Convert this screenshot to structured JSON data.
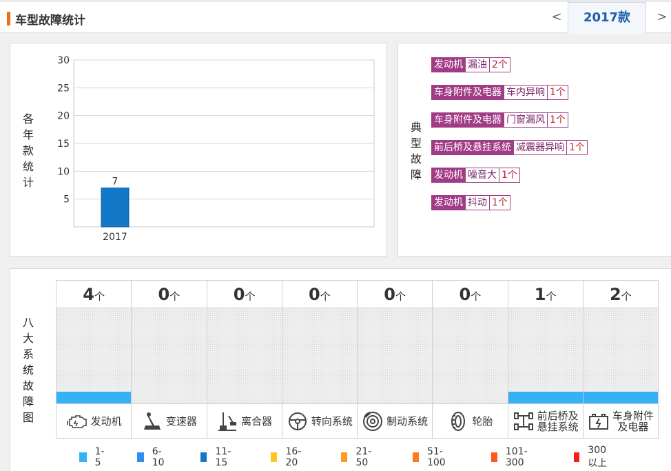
{
  "header": {
    "title": "车型故障统计"
  },
  "tabs": {
    "prev": "<",
    "next": ">",
    "active": "2017款"
  },
  "year_panel": {
    "label": "各年款统计",
    "chart_data": {
      "type": "bar",
      "categories": [
        "2017"
      ],
      "values": [
        7
      ],
      "ylim": [
        0,
        30
      ],
      "yticks": [
        5,
        10,
        15,
        20,
        25,
        30
      ],
      "grid": true,
      "color": "#1478c8"
    }
  },
  "fault_panel": {
    "label": "典型故障",
    "items": [
      {
        "category": "发动机",
        "issue": "漏油",
        "count": "2个"
      },
      {
        "category": "车身附件及电器",
        "issue": "车内异响",
        "count": "1个"
      },
      {
        "category": "车身附件及电器",
        "issue": "门窗漏风",
        "count": "1个"
      },
      {
        "category": "前后桥及悬挂系统",
        "issue": "减震器异响",
        "count": "1个"
      },
      {
        "category": "发动机",
        "issue": "噪音大",
        "count": "1个"
      },
      {
        "category": "发动机",
        "issue": "抖动",
        "count": "1个"
      }
    ]
  },
  "systems_panel": {
    "label": "八大系统故障图",
    "unit": "个",
    "systems": [
      {
        "name": "发动机",
        "count": "4",
        "level": 0.1,
        "icon": "engine-icon"
      },
      {
        "name": "变速器",
        "count": "0",
        "level": 0,
        "icon": "gear-shifter-icon"
      },
      {
        "name": "离合器",
        "count": "0",
        "level": 0,
        "icon": "clutch-pedal-icon"
      },
      {
        "name": "转向系统",
        "count": "0",
        "level": 0,
        "icon": "steering-wheel-icon"
      },
      {
        "name": "制动系统",
        "count": "0",
        "level": 0,
        "icon": "brake-disc-icon"
      },
      {
        "name": "轮胎",
        "count": "0",
        "level": 0,
        "icon": "tire-icon"
      },
      {
        "name": "前后桥及悬挂系统",
        "name_lines": [
          "前后桥及",
          "悬挂系统"
        ],
        "count": "1",
        "level": 0.1,
        "icon": "suspension-icon"
      },
      {
        "name": "车身附件及电器",
        "name_lines": [
          "车身附件",
          "及电器"
        ],
        "count": "2",
        "level": 0.1,
        "icon": "battery-icon"
      }
    ],
    "fill_color": "#35b1f6",
    "legend": [
      {
        "label": "1-5",
        "color": "#35b1f6"
      },
      {
        "label": "6-10",
        "color": "#2e8ff0"
      },
      {
        "label": "11-15",
        "color": "#1478c8"
      },
      {
        "label": "16-20",
        "color": "#ffc61e"
      },
      {
        "label": "21-50",
        "color": "#ff9a1e"
      },
      {
        "label": "51-100",
        "color": "#ff7a1e"
      },
      {
        "label": "101-300",
        "color": "#ff5a1e"
      },
      {
        "label": "300以上",
        "color": "#ff1a1a"
      }
    ]
  }
}
